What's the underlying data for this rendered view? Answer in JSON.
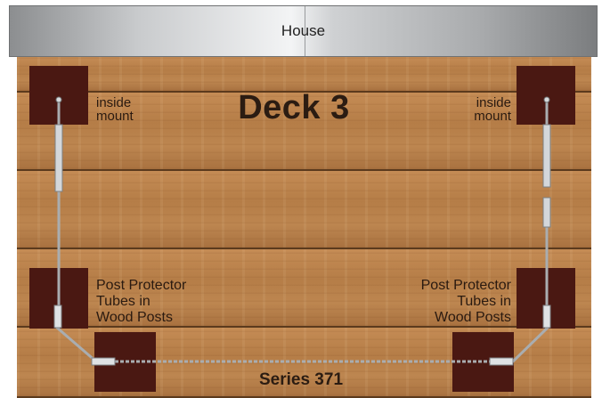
{
  "house": {
    "label": "House"
  },
  "deck": {
    "title": "Deck 3"
  },
  "labels": {
    "inside_mount_left": [
      "inside",
      "mount"
    ],
    "inside_mount_right": [
      "inside",
      "mount"
    ],
    "post_protector_left": [
      "Post Protector",
      "Tubes in",
      "Wood Posts"
    ],
    "post_protector_right": [
      "Post Protector",
      "Tubes in",
      "Wood Posts"
    ]
  },
  "series": {
    "label": "Series 371"
  },
  "colors": {
    "post": "#4a1812",
    "wood": "#b57d47",
    "house_metal": "#c9cbcd",
    "cable": "#9da1a4"
  }
}
